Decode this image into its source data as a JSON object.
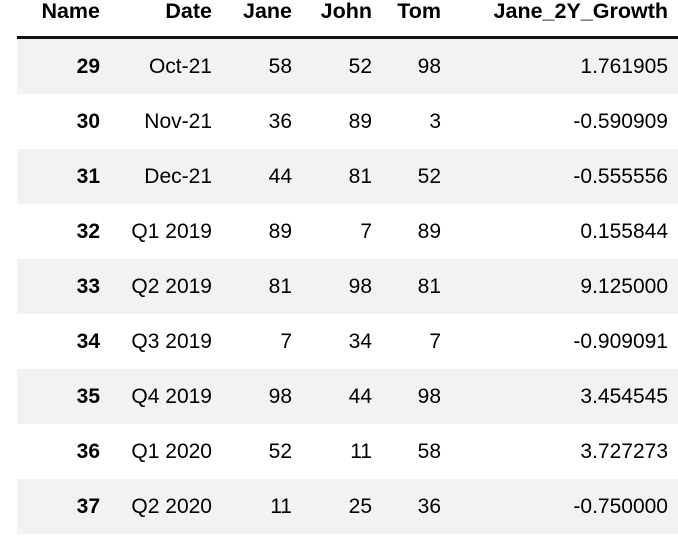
{
  "table": {
    "index_header": "Name",
    "columns": [
      "Date",
      "Jane",
      "John",
      "Tom",
      "Jane_2Y_Growth"
    ],
    "row_shading_color": "#f2f2f2",
    "header_rule_color": "#111111",
    "rows": [
      {
        "index": "29",
        "date": "Oct-21",
        "jane": "58",
        "john": "52",
        "tom": "98",
        "growth": "1.761905"
      },
      {
        "index": "30",
        "date": "Nov-21",
        "jane": "36",
        "john": "89",
        "tom": "3",
        "growth": "-0.590909"
      },
      {
        "index": "31",
        "date": "Dec-21",
        "jane": "44",
        "john": "81",
        "tom": "52",
        "growth": "-0.555556"
      },
      {
        "index": "32",
        "date": "Q1 2019",
        "jane": "89",
        "john": "7",
        "tom": "89",
        "growth": "0.155844"
      },
      {
        "index": "33",
        "date": "Q2 2019",
        "jane": "81",
        "john": "98",
        "tom": "81",
        "growth": "9.125000"
      },
      {
        "index": "34",
        "date": "Q3 2019",
        "jane": "7",
        "john": "34",
        "tom": "7",
        "growth": "-0.909091"
      },
      {
        "index": "35",
        "date": "Q4 2019",
        "jane": "98",
        "john": "44",
        "tom": "98",
        "growth": "3.454545"
      },
      {
        "index": "36",
        "date": "Q1 2020",
        "jane": "52",
        "john": "11",
        "tom": "58",
        "growth": "3.727273"
      },
      {
        "index": "37",
        "date": "Q2 2020",
        "jane": "11",
        "john": "25",
        "tom": "36",
        "growth": "-0.750000"
      }
    ]
  }
}
